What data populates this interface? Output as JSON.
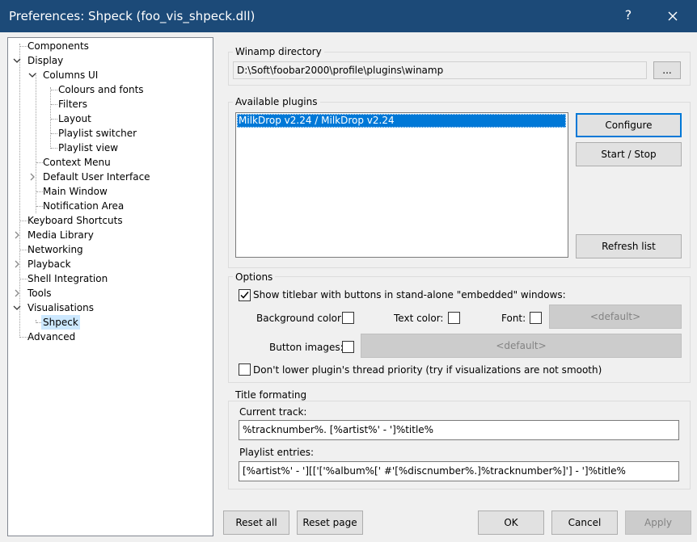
{
  "window": {
    "title": "Preferences: Shpeck (foo_vis_shpeck.dll)",
    "help_label": "?"
  },
  "tree": {
    "items": [
      {
        "label": "Components"
      },
      {
        "label": "Display"
      },
      {
        "label": "Columns UI"
      },
      {
        "label": "Colours and fonts"
      },
      {
        "label": "Filters"
      },
      {
        "label": "Layout"
      },
      {
        "label": "Playlist switcher"
      },
      {
        "label": "Playlist view"
      },
      {
        "label": "Context Menu"
      },
      {
        "label": "Default User Interface"
      },
      {
        "label": "Main Window"
      },
      {
        "label": "Notification Area"
      },
      {
        "label": "Keyboard Shortcuts"
      },
      {
        "label": "Media Library"
      },
      {
        "label": "Networking"
      },
      {
        "label": "Playback"
      },
      {
        "label": "Shell Integration"
      },
      {
        "label": "Tools"
      },
      {
        "label": "Visualisations"
      },
      {
        "label": "Shpeck"
      },
      {
        "label": "Advanced"
      }
    ]
  },
  "winamp_dir": {
    "label": "Winamp directory",
    "path": "D:\\Soft\\foobar2000\\profile\\plugins\\winamp",
    "browse_label": "..."
  },
  "plugins": {
    "label": "Available plugins",
    "items": [
      "MilkDrop v2.24 / MilkDrop v2.24"
    ],
    "configure_label": "Configure",
    "start_stop_label": "Start / Stop",
    "refresh_label": "Refresh list"
  },
  "options": {
    "label": "Options",
    "show_titlebar_label": "Show titlebar with buttons in stand-alone \"embedded\" windows:",
    "show_titlebar_checked": true,
    "bg_color_label": "Background color:",
    "text_color_label": "Text color:",
    "font_label": "Font:",
    "font_value": "<default>",
    "button_images_label": "Button images:",
    "button_images_value": "<default>",
    "thread_priority_label": "Don't lower plugin's thread priority (try if visualizations are not smooth)",
    "thread_priority_checked": false
  },
  "title_formatting": {
    "label": "Title formating",
    "current_track_label": "Current track:",
    "current_track_value": "%tracknumber%. [%artist%' - ']%title%",
    "playlist_entries_label": "Playlist entries:",
    "playlist_entries_value": "[%artist%' - '][['['%album%[' #'[%discnumber%.]%tracknumber%]'] - ']%title%"
  },
  "footer": {
    "reset_all_label": "Reset all",
    "reset_page_label": "Reset page",
    "ok_label": "OK",
    "cancel_label": "Cancel",
    "apply_label": "Apply"
  },
  "colors": {
    "titlebar": "#1c4a78",
    "selection": "#0078d7",
    "tree_selection": "#cce8ff"
  }
}
